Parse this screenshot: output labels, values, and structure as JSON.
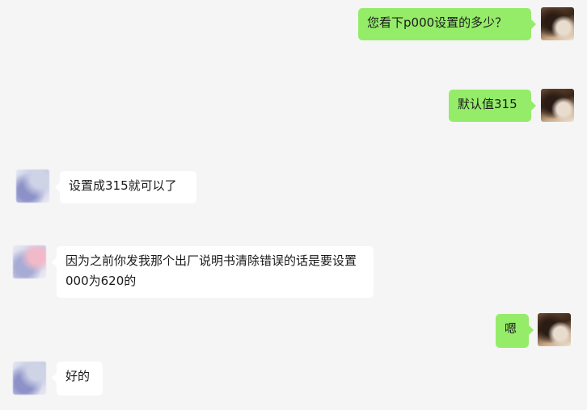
{
  "messages": [
    {
      "side": "right",
      "text": "您看下p000设置的多少？"
    },
    {
      "side": "right",
      "text": "默认值315"
    },
    {
      "side": "left",
      "text": "设置成315就可以了"
    },
    {
      "side": "left",
      "text": "因为之前你发我那个出厂说明书清除错误的话是要设置000为620的"
    },
    {
      "side": "right",
      "text": "嗯"
    },
    {
      "side": "left",
      "text": "好的"
    }
  ],
  "colors": {
    "background": "#f5f5f5",
    "self_bubble": "#95ec69",
    "other_bubble": "#ffffff",
    "text": "#1b1b1b"
  }
}
